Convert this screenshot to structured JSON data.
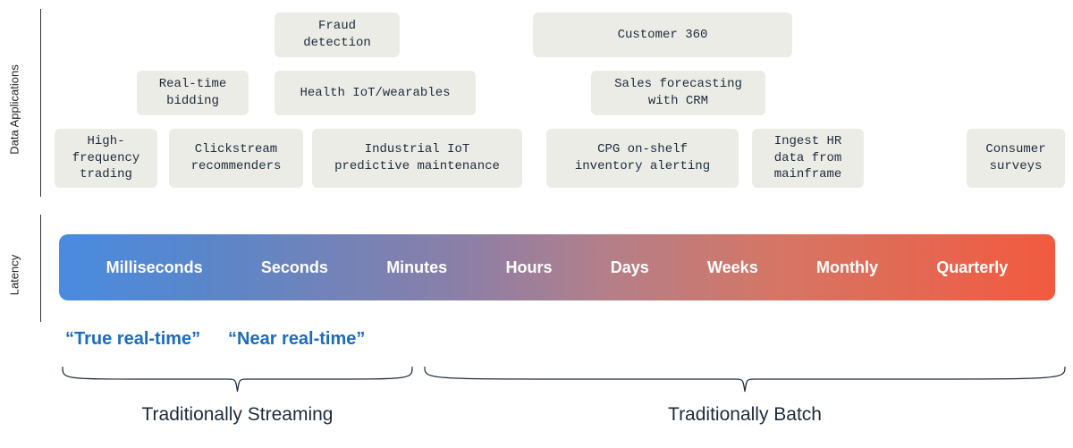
{
  "sections": {
    "apps_label": "Data Applications",
    "latency_label": "Latency"
  },
  "apps": {
    "fraud": "Fraud\ndetection",
    "cust360": "Customer 360",
    "rtb": "Real-time\nbidding",
    "health": "Health IoT/wearables",
    "sales": "Sales forecasting\nwith CRM",
    "hft": "High-\nfrequency\ntrading",
    "click": "Clickstream\nrecommenders",
    "industrial": "Industrial IoT\npredictive maintenance",
    "cpg": "CPG on-shelf\ninventory alerting",
    "hr": "Ingest HR\ndata from\nmainframe",
    "consumer": "Consumer\nsurveys"
  },
  "latency": {
    "items": [
      "Milliseconds",
      "Seconds",
      "Minutes",
      "Hours",
      "Days",
      "Weeks",
      "Monthly",
      "Quarterly"
    ]
  },
  "bottom": {
    "true_rt": "“True real-time”",
    "near_rt": "“Near real-time”",
    "streaming": "Traditionally Streaming",
    "batch": "Traditionally Batch"
  }
}
